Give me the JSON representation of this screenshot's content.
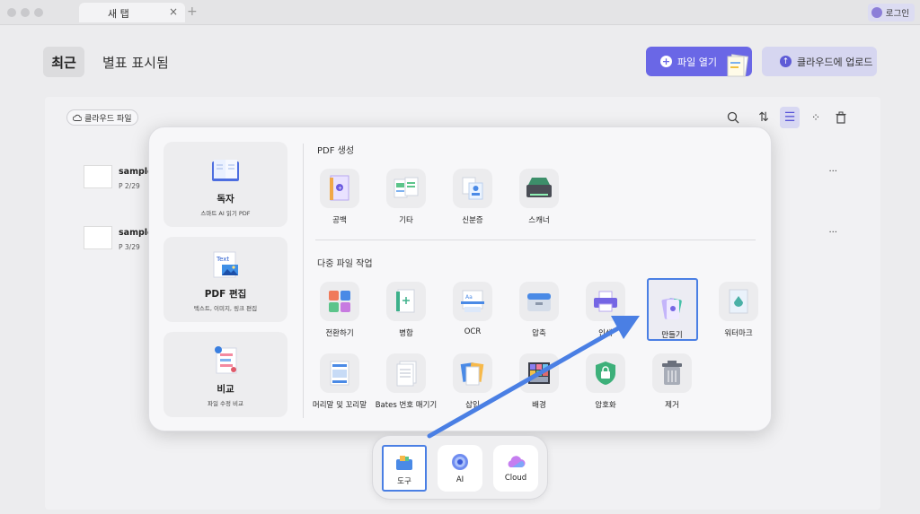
{
  "window": {
    "tab_title": "새 탭",
    "tab_close": "×",
    "new_tab": "+",
    "login_label": "로그인"
  },
  "header": {
    "tabs": [
      {
        "label": "최근"
      },
      {
        "label": "별표 표시됨"
      }
    ],
    "open_button": "파일 열기",
    "upload_button": "클라우드에 업로드"
  },
  "file_panel": {
    "cloud_filter": "클라우드 파일",
    "files": [
      {
        "name": "sample-",
        "meta": "P 2/29",
        "more": "···"
      },
      {
        "name": "sample-",
        "meta": "P 3/29",
        "more": "···"
      }
    ]
  },
  "popup": {
    "cards": [
      {
        "title": "독자",
        "subtitle": "스마트 AI 읽기 PDF"
      },
      {
        "title": "PDF 편집",
        "subtitle": "텍스트, 이미지, 링크 편집"
      },
      {
        "title": "비교",
        "subtitle": "파일 수정 비교"
      }
    ],
    "create_section": {
      "title": "PDF 생성",
      "tools": [
        {
          "label": "공백"
        },
        {
          "label": "기타"
        },
        {
          "label": "신분증"
        },
        {
          "label": "스캐너"
        }
      ]
    },
    "batch_section": {
      "title": "다중 파일 작업",
      "tools": [
        {
          "label": "전환하기"
        },
        {
          "label": "병합"
        },
        {
          "label": "OCR"
        },
        {
          "label": "압축"
        },
        {
          "label": "인쇄"
        },
        {
          "label": "만들기"
        },
        {
          "label": "워터마크"
        },
        {
          "label": "머리말 및 꼬리말"
        },
        {
          "label": "Bates 번호 매기기"
        },
        {
          "label": "삽입"
        },
        {
          "label": "배경"
        },
        {
          "label": "암호화"
        },
        {
          "label": "제거"
        }
      ]
    },
    "highlighted_tool": "만들기",
    "edit_icon_text": "Text"
  },
  "dock": {
    "items": [
      {
        "label": "도구"
      },
      {
        "label": "AI"
      },
      {
        "label": "Cloud"
      }
    ],
    "active": "도구"
  },
  "colors": {
    "accent": "#6a67e6",
    "highlight": "#4a7fe4",
    "secondary": "#d6d6f0"
  }
}
